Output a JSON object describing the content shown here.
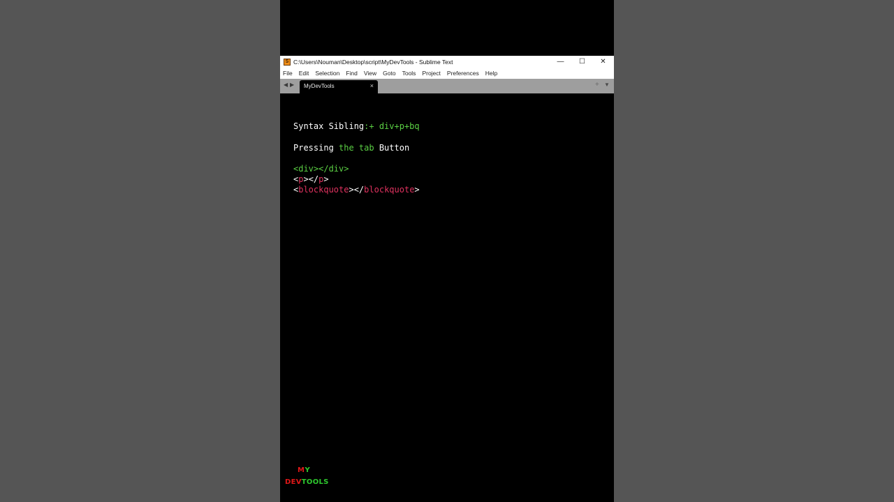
{
  "window": {
    "title": "C:\\Users\\Nouman\\Desktop\\script\\MyDevTools - Sublime Text",
    "app_icon": "sublime-text-icon",
    "controls": {
      "minimize": "—",
      "maximize": "☐",
      "close": "✕"
    }
  },
  "menubar": {
    "items": [
      "File",
      "Edit",
      "Selection",
      "Find",
      "View",
      "Goto",
      "Tools",
      "Project",
      "Preferences",
      "Help"
    ]
  },
  "tabbar": {
    "nav_left": "◀",
    "nav_right": "▶",
    "active_tab": {
      "label": "MyDevTools",
      "close": "×"
    },
    "new_tab": "+",
    "tab_menu": "▼"
  },
  "editor": {
    "line1": {
      "a": "Syntax Sibling",
      "b": ":+ div+p+bq"
    },
    "line2": {
      "a": "Pressing ",
      "b": "the tab",
      "c": " Button"
    },
    "line3": {
      "a": "<div></div>"
    },
    "line4": {
      "a": "<",
      "b": "p",
      "c": "></",
      "d": "p",
      "e": ">"
    },
    "line5": {
      "a": "<",
      "b": "blockquote",
      "c": "></",
      "d": "blockquote",
      "e": ">"
    }
  },
  "logo": {
    "my_m": "M",
    "my_y": "Y",
    "dev": "DEV",
    "tools": "TOOLS"
  },
  "colors": {
    "background": "#555555",
    "editor_bg": "#000000",
    "green": "#5bd044",
    "red": "#e0325f",
    "tabbar": "#9e9e9e"
  }
}
